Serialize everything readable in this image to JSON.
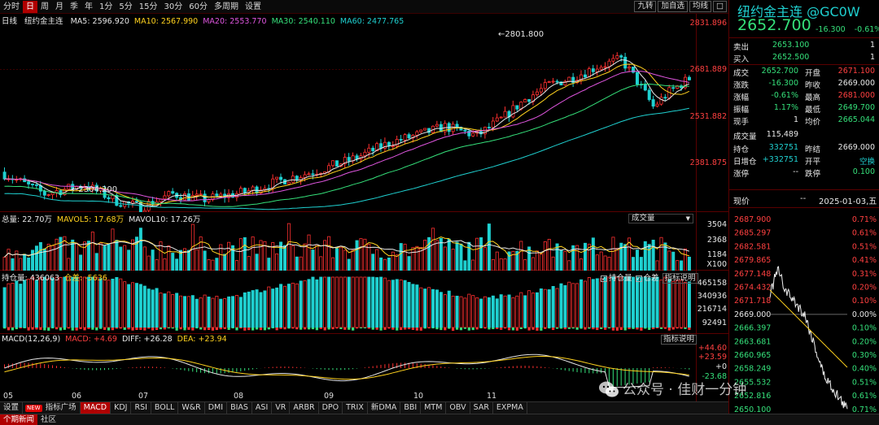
{
  "toolbar": {
    "periods": [
      "分时",
      "日",
      "周",
      "月",
      "季",
      "年",
      "1分",
      "5分",
      "15分",
      "30分",
      "60分",
      "多周期",
      "设置"
    ],
    "active_period": "日",
    "right_buttons": [
      "九转",
      "加自选",
      "均线",
      "□"
    ]
  },
  "kline": {
    "label": "日线",
    "name": "纽约金主连",
    "ma": [
      {
        "label": "MA5: 2596.920",
        "color": "#e8e8e8"
      },
      {
        "label": "MA10: 2567.990",
        "color": "#ffd21e"
      },
      {
        "label": "MA20: 2553.770",
        "color": "#e056e0"
      },
      {
        "label": "MA30: 2540.110",
        "color": "#35e07a"
      },
      {
        "label": "MA60: 2477.765",
        "color": "#1fd0d0"
      }
    ],
    "axis_labels": [
      "2831.896",
      "2681.889",
      "2531.882",
      "2381.875"
    ],
    "high_label": "2801.800",
    "low_label": "2304.200",
    "x_labels": [
      "05",
      "06",
      "07",
      "08",
      "09",
      "10",
      "11"
    ]
  },
  "volume": {
    "head": [
      {
        "label": "总量: 22.70万",
        "color": "#e8e8e8"
      },
      {
        "label": "MAVOL5: 17.68万",
        "color": "#ffd21e"
      },
      {
        "label": "MAVOL10: 17.26万",
        "color": "#e8e8e8"
      }
    ],
    "dropdown": "成交量",
    "axis_labels": [
      "3504",
      "2368",
      "1184",
      "X100"
    ]
  },
  "openint": {
    "head": [
      {
        "label": "持仓量: 436063",
        "color": "#e8e8e8"
      },
      {
        "label": "仓差: -5636",
        "color": "#ffd21e"
      }
    ],
    "checkboxes": [
      "持仓量",
      "仓差"
    ],
    "help": "指标说明",
    "axis_labels": [
      "465158",
      "340936",
      "216714",
      "92491"
    ]
  },
  "macd": {
    "head": [
      {
        "label": "MACD(12,26,9)",
        "color": "#e8e8e8"
      },
      {
        "label": "MACD: +4.69",
        "color": "#ff4040"
      },
      {
        "label": "DIFF: +26.28",
        "color": "#e8e8e8"
      },
      {
        "label": "DEA: +23.94",
        "color": "#ffd21e"
      }
    ],
    "help": "指标说明",
    "axis_labels": [
      "+44.60",
      "+23.59",
      "+0",
      "-23.68"
    ]
  },
  "indicator_tabs": [
    "设置",
    "指标广场",
    "MACD",
    "KDJ",
    "RSI",
    "BOLL",
    "W&R",
    "DMI",
    "BIAS",
    "ASI",
    "VR",
    "ARBR",
    "DPO",
    "TRIX",
    "新DMA",
    "BBI",
    "MTM",
    "OBV",
    "SAR",
    "EXPMA"
  ],
  "indicator_active": "MACD",
  "indicator_new_badge": "NEW",
  "bottom_tabs": [
    "个期新闻",
    "社区"
  ],
  "quote": {
    "title": "纽约金主连 @GC0W",
    "price": "2652.700",
    "change": "-16.300",
    "change_pct": "-0.61%",
    "sell": {
      "label": "卖出",
      "price": "2653.100",
      "qty": "1"
    },
    "buy": {
      "label": "买入",
      "price": "2652.500",
      "qty": "1"
    },
    "rows": [
      {
        "l1": "成交",
        "v1": "2652.700",
        "c1": "#35e07a",
        "l2": "开盘",
        "v2": "2671.100",
        "c2": "#ff4040"
      },
      {
        "l1": "涨跌",
        "v1": "-16.300",
        "c1": "#35e07a",
        "l2": "昨收",
        "v2": "2669.000",
        "c2": "#e8e8e8"
      },
      {
        "l1": "涨幅",
        "v1": "-0.61%",
        "c1": "#35e07a",
        "l2": "最高",
        "v2": "2681.000",
        "c2": "#ff4040"
      },
      {
        "l1": "振幅",
        "v1": "1.17%",
        "c1": "#35e07a",
        "l2": "最低",
        "v2": "2649.700",
        "c2": "#35e07a"
      },
      {
        "l1": "现手",
        "v1": "1",
        "c1": "#e8e8e8",
        "l2": "均价",
        "v2": "2665.044",
        "c2": "#35e07a"
      },
      {
        "l1": "成交量",
        "v1": "115,489",
        "c1": "#e8e8e8",
        "l2": "",
        "v2": "",
        "c2": "#e8e8e8"
      },
      {
        "l1": "持仓",
        "v1": "332751",
        "c1": "#1fd0d0",
        "l2": "昨结",
        "v2": "2669.000",
        "c2": "#e8e8e8"
      },
      {
        "l1": "日增仓",
        "v1": "+332751",
        "c1": "#1fd0d0",
        "l2": "开平",
        "v2": "空换",
        "c2": "#1fd0d0"
      },
      {
        "l1": "涨停",
        "v1": "--",
        "c1": "#e8e8e8",
        "l2": "跌停",
        "v2": "0.100",
        "c2": "#35e07a"
      }
    ],
    "tick_label": "现价",
    "tick_dash": "--",
    "tick_date": "2025-01-03,五",
    "tick_prices": [
      "2687.900",
      "2685.297",
      "2682.581",
      "2679.865",
      "2677.148",
      "2674.432",
      "2671.718",
      "2669.000",
      "2666.397",
      "2663.681",
      "2660.965",
      "2658.249",
      "2655.532",
      "2652.816",
      "2650.100"
    ],
    "tick_pcts": [
      "0.71%",
      "0.61%",
      "0.51%",
      "0.41%",
      "0.31%",
      "0.20%",
      "0.10%",
      "0.00%",
      "0.10%",
      "0.20%",
      "0.30%",
      "0.40%",
      "0.51%",
      "0.61%",
      "0.71%"
    ]
  },
  "watermark": "公众号 · 佳财一分钟"
}
